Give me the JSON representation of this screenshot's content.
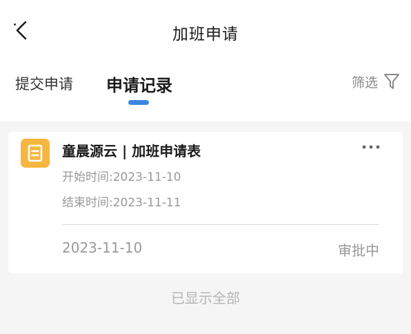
{
  "header": {
    "title": "加班申请",
    "back_icon": "chevron-left-icon"
  },
  "tabs": [
    {
      "label": "提交申请",
      "active": false
    },
    {
      "label": "申请记录",
      "active": true
    }
  ],
  "filter": {
    "label": "筛选",
    "icon": "funnel-icon"
  },
  "records": [
    {
      "icon": "document-icon",
      "title": "童晨源云 | 加班申请表",
      "start": "开始时间:2023-11-10",
      "end": "结束时间:2023-11-11",
      "date": "2023-11-10",
      "status": "审批中"
    }
  ],
  "footer_note": "已显示全部",
  "colors": {
    "accent": "#3a86e0",
    "doc_icon": "#f6b63f",
    "muted_text": "#999999"
  }
}
